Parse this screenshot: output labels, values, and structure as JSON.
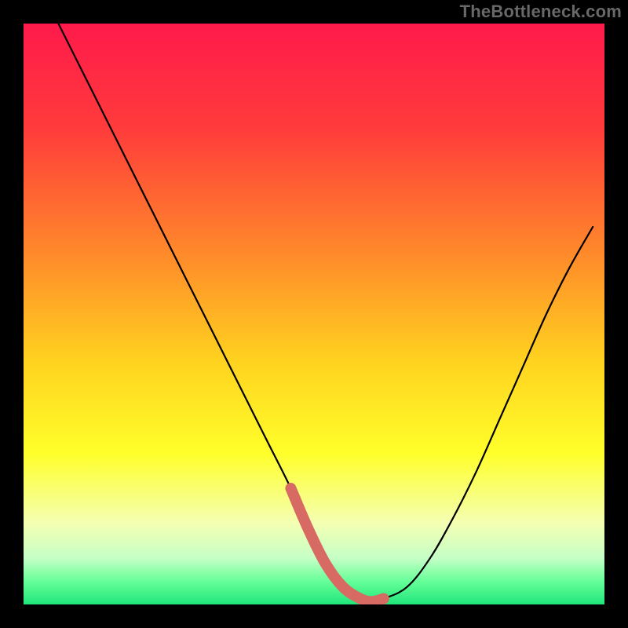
{
  "watermark": "TheBottleneck.com",
  "colors": {
    "frame": "#000000",
    "watermark": "#686868",
    "curve_stroke": "#000000",
    "valley_stroke": "#d86a64",
    "gradient_stops": [
      {
        "offset": 0.0,
        "color": "#ff1a4b"
      },
      {
        "offset": 0.18,
        "color": "#ff3b3b"
      },
      {
        "offset": 0.4,
        "color": "#ff8b2a"
      },
      {
        "offset": 0.58,
        "color": "#ffd21f"
      },
      {
        "offset": 0.74,
        "color": "#ffff2a"
      },
      {
        "offset": 0.86,
        "color": "#f4ffb3"
      },
      {
        "offset": 0.92,
        "color": "#c6ffc6"
      },
      {
        "offset": 0.96,
        "color": "#66ff99"
      },
      {
        "offset": 1.0,
        "color": "#20e67a"
      }
    ]
  },
  "chart_data": {
    "type": "line",
    "title": "",
    "xlabel": "",
    "ylabel": "",
    "xlim": [
      0,
      100
    ],
    "ylim": [
      0,
      100
    ],
    "x": [
      6,
      10,
      14,
      18,
      22,
      26,
      30,
      34,
      38,
      42,
      46,
      49,
      52,
      55,
      58,
      60,
      62,
      66,
      70,
      74,
      78,
      82,
      86,
      90,
      94,
      98
    ],
    "values": [
      100,
      92,
      84,
      76,
      68,
      60,
      52,
      44,
      36,
      28,
      20,
      13,
      7,
      3,
      1,
      0.5,
      1,
      3,
      8,
      15,
      23,
      32,
      41,
      50,
      58,
      65
    ],
    "valley_segment": {
      "x": [
        46,
        49,
        52,
        55,
        58,
        60,
        62
      ],
      "values": [
        20,
        13,
        7,
        3,
        1,
        0.5,
        1
      ]
    }
  }
}
